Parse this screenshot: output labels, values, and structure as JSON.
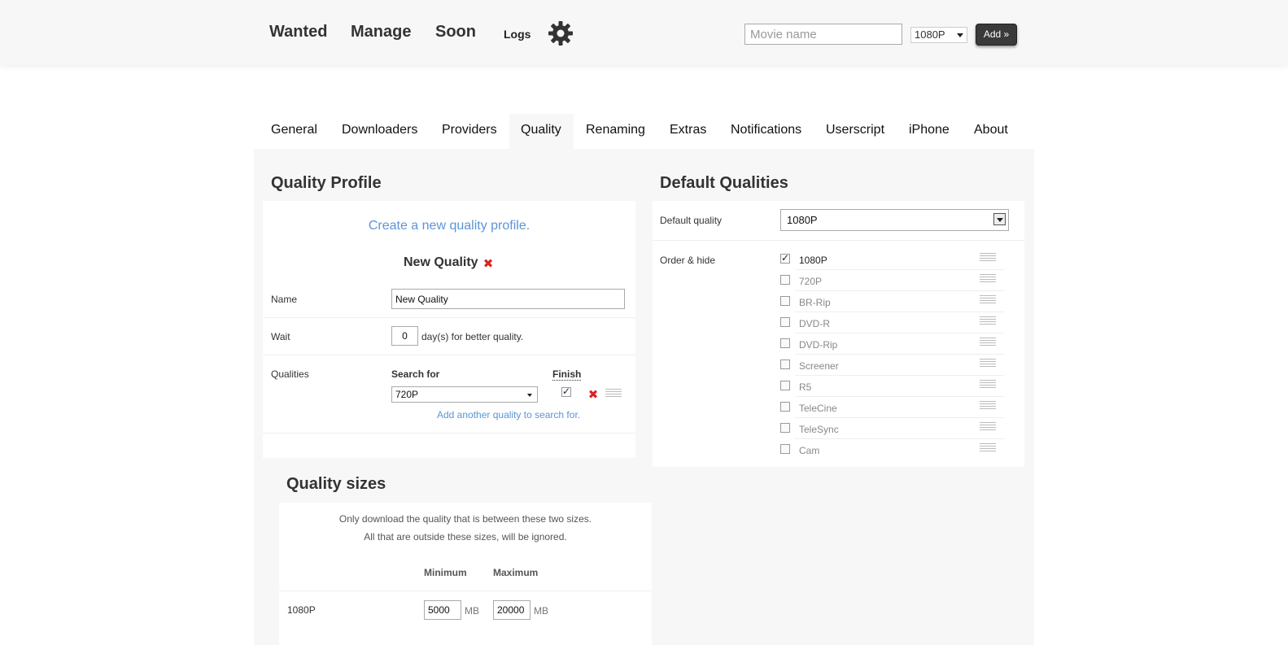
{
  "header": {
    "nav": [
      {
        "label": "Wanted"
      },
      {
        "label": "Manage"
      },
      {
        "label": "Soon"
      }
    ],
    "logs_label": "Logs",
    "settings_icon": "gear-icon",
    "search": {
      "placeholder": "Movie name",
      "value": ""
    },
    "quality_select": {
      "value": "1080P"
    },
    "add_label": "Add »"
  },
  "tabs": [
    {
      "label": "General"
    },
    {
      "label": "Downloaders"
    },
    {
      "label": "Providers"
    },
    {
      "label": "Quality",
      "active": true
    },
    {
      "label": "Renaming"
    },
    {
      "label": "Extras"
    },
    {
      "label": "Notifications"
    },
    {
      "label": "Userscript"
    },
    {
      "label": "iPhone"
    },
    {
      "label": "About"
    }
  ],
  "quality_profile": {
    "title": "Quality Profile",
    "create_link": "Create a new quality profile.",
    "profile_name": "New Quality",
    "name_label": "Name",
    "name_value": "New Quality",
    "wait_label": "Wait",
    "wait_value": "0",
    "wait_suffix": "day(s) for better quality.",
    "qualities_label": "Qualities",
    "search_for_label": "Search for",
    "finish_label": "Finish",
    "search_for_value": "720P",
    "finish_checked": true,
    "add_another": "Add another quality to search for."
  },
  "quality_sizes": {
    "title": "Quality sizes",
    "desc1": "Only download the quality that is between these two sizes.",
    "desc2": "All that are outside these sizes, will be ignored.",
    "min_label": "Minimum",
    "max_label": "Maximum",
    "rows": [
      {
        "label": "1080P",
        "min": "5000",
        "max": "20000",
        "unit": "MB"
      }
    ]
  },
  "default_qualities": {
    "title": "Default Qualities",
    "default_label": "Default quality",
    "default_value": "1080P",
    "order_label": "Order & hide",
    "items": [
      {
        "label": "1080P",
        "checked": true
      },
      {
        "label": "720P",
        "checked": false
      },
      {
        "label": "BR-Rip",
        "checked": false
      },
      {
        "label": "DVD-R",
        "checked": false
      },
      {
        "label": "DVD-Rip",
        "checked": false
      },
      {
        "label": "Screener",
        "checked": false
      },
      {
        "label": "R5",
        "checked": false
      },
      {
        "label": "TeleCine",
        "checked": false
      },
      {
        "label": "TeleSync",
        "checked": false
      },
      {
        "label": "Cam",
        "checked": false
      }
    ]
  }
}
